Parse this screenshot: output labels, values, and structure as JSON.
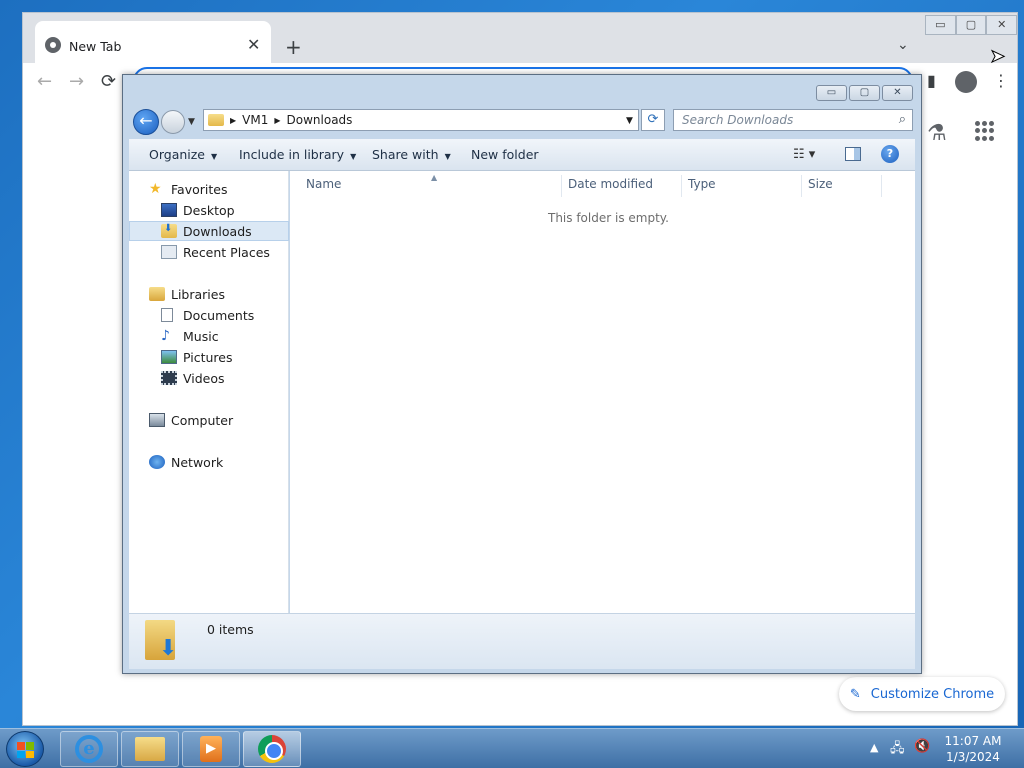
{
  "chrome": {
    "tab_title": "New Tab",
    "tab_close": "✕",
    "new_tab": "+",
    "tab_search": "⌄",
    "window_buttons": [
      "▭",
      "▢",
      "✕"
    ],
    "nav_back": "←",
    "nav_forward": "→",
    "reload": "⟳",
    "customize_label": "Customize Chrome",
    "customize_icon": "✎",
    "labs_icon": "⚗"
  },
  "explorer": {
    "caption_buttons": [
      "▭",
      "▢",
      "✕"
    ],
    "breadcrumb": [
      "VM1",
      "Downloads"
    ],
    "search_placeholder": "Search Downloads",
    "commands": {
      "organize": "Organize",
      "include_in_library": "Include in library",
      "share_with": "Share with",
      "new_folder": "New folder"
    },
    "help": "?",
    "nav": {
      "favorites": "Favorites",
      "desktop": "Desktop",
      "downloads": "Downloads",
      "recent_places": "Recent Places",
      "libraries": "Libraries",
      "documents": "Documents",
      "music": "Music",
      "pictures": "Pictures",
      "videos": "Videos",
      "computer": "Computer",
      "network": "Network"
    },
    "columns": {
      "name": "Name",
      "date_modified": "Date modified",
      "type": "Type",
      "size": "Size"
    },
    "empty_message": "This folder is empty.",
    "item_count": "0 items"
  },
  "taskbar": {
    "clock_time": "11:07 AM",
    "clock_date": "1/3/2024",
    "tray_arrow": "▲"
  }
}
